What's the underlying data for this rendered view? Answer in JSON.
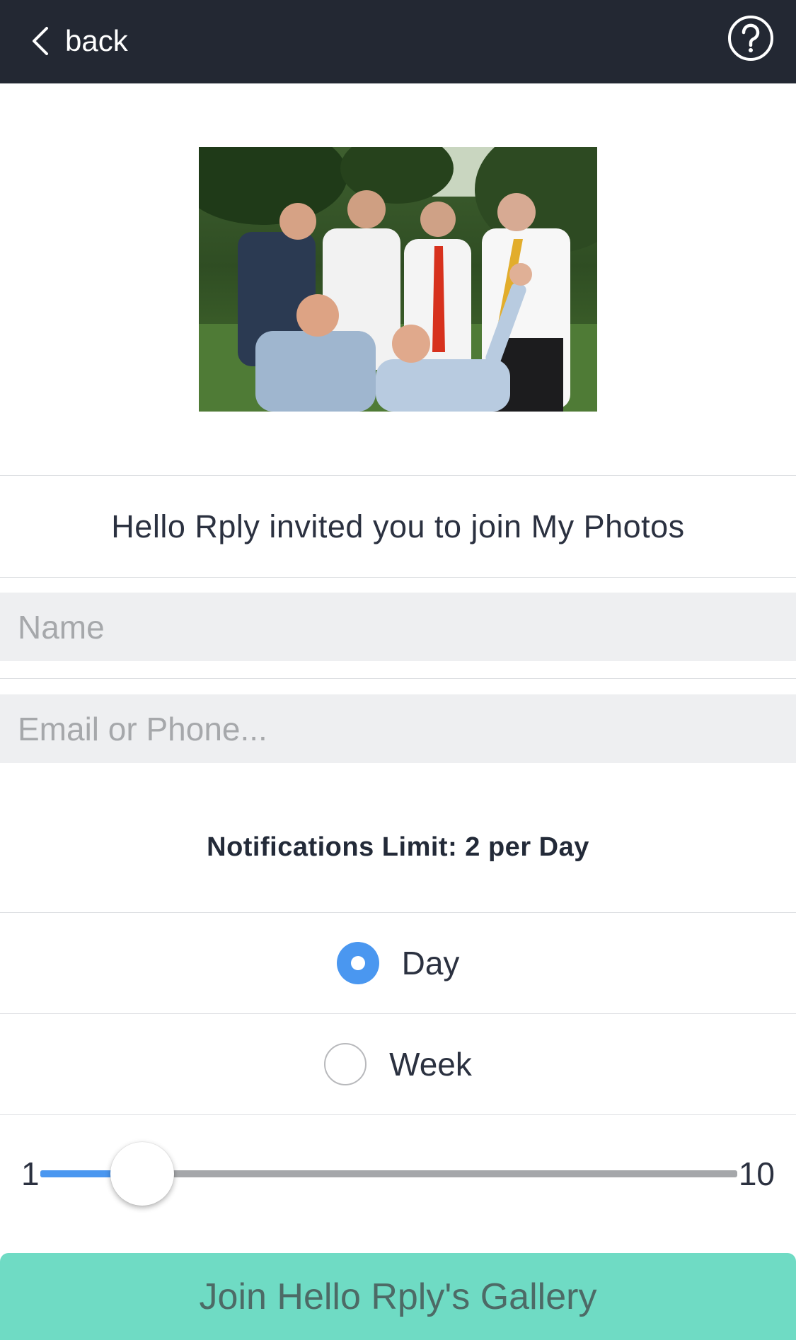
{
  "header": {
    "back_label": "back",
    "back_icon": "chevron-left-icon",
    "help_icon": "question-circle-icon"
  },
  "invite": {
    "text": "Hello Rply invited you to join My Photos"
  },
  "form": {
    "name_placeholder": "Name",
    "name_value": "",
    "contact_placeholder": "Email or Phone...",
    "contact_value": ""
  },
  "notifications": {
    "title": "Notifications Limit: 2 per Day",
    "options": [
      {
        "label": "Day",
        "selected": true
      },
      {
        "label": "Week",
        "selected": false
      }
    ],
    "slider": {
      "min_label": "1",
      "max_label": "10",
      "min": 1,
      "max": 10,
      "value": 2
    }
  },
  "join_button": {
    "label": "Join Hello Rply's Gallery"
  },
  "colors": {
    "header_bg": "#232833",
    "accent_blue": "#4a97f0",
    "join_bg": "#6fdbc4",
    "field_bg": "#eeeff1"
  }
}
